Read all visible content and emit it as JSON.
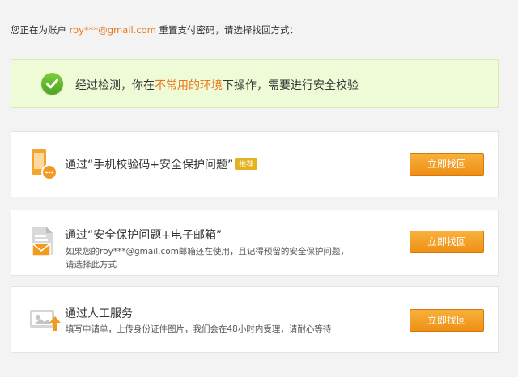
{
  "intro": {
    "prefix": "您正在为账户 ",
    "account": "roy***@gmail.com",
    "suffix": " 重置支付密码，请选择找回方式："
  },
  "notice": {
    "part1": "经过检测，你在",
    "highlight": "不常用的环境",
    "part2": "下操作，需要进行安全校验",
    "icon": "check-circle-icon"
  },
  "options": [
    {
      "title": "通过“手机校验码+安全保护问题”",
      "badge": "推荐",
      "icon": "phone-icon",
      "button": "立即找回"
    },
    {
      "title": "通过“安全保护问题+电子邮箱”",
      "desc_line1": "如果您的roy***@gmail.com邮箱还在使用，且记得预留的安全保护问题，",
      "desc_line2": "请选择此方式",
      "icon": "email-document-icon",
      "button": "立即找回"
    },
    {
      "title": "通过人工服务",
      "desc_line1": "填写申请单，上传身份证件图片，我们会在48小时内受理，请耐心等待",
      "icon": "id-card-upload-icon",
      "button": "立即找回"
    }
  ],
  "colors": {
    "accent": "#e8761a",
    "button": "#f29a1f",
    "notice_bg": "#effad6",
    "check": "#5cb82a",
    "badge": "#e6b11f"
  }
}
